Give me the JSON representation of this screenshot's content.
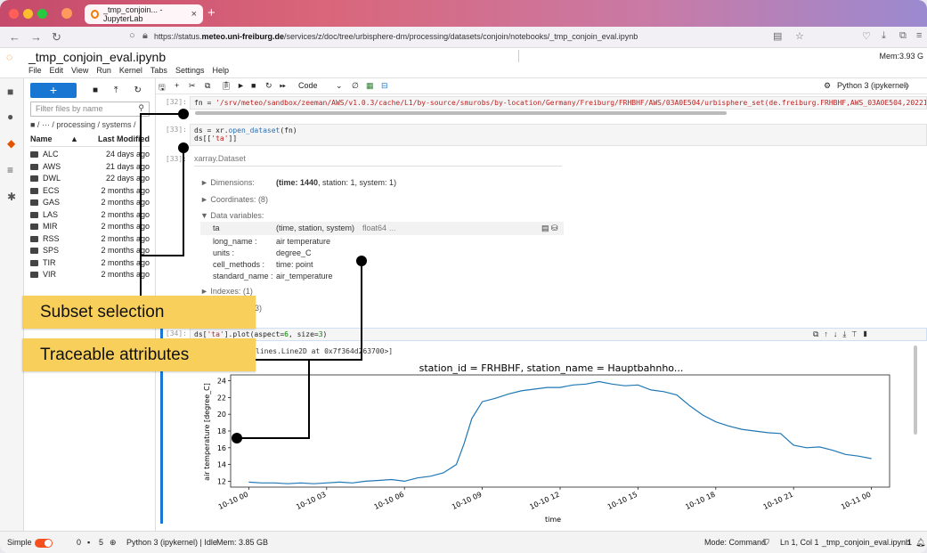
{
  "browser": {
    "tab_title": "_tmp_conjoin... - JupyterLab",
    "url_prefix": "https://status.",
    "url_domain": "meteo.uni-freiburg.de",
    "url_rest": "/services/z/doc/tree/urbisphere-dm/processing/datasets/conjoin/notebooks/_tmp_conjoin_eval.ipynb"
  },
  "jupyter": {
    "notebook_title": "_tmp_conjoin_eval.ipynb",
    "menu": [
      "File",
      "Edit",
      "View",
      "Run",
      "Kernel",
      "Tabs",
      "Settings",
      "Help"
    ],
    "memory": "Mem:3.93 G",
    "kernel": "Python 3 (ipykernel)",
    "cell_type": "Code"
  },
  "filebrowser": {
    "new_label": "+",
    "filter_placeholder": "Filter files by name",
    "breadcrumb": "■ / ··· / processing / systems /",
    "col_name": "Name",
    "col_modified": "Last Modified",
    "items": [
      {
        "name": "ALC",
        "modified": "24 days ago"
      },
      {
        "name": "AWS",
        "modified": "21 days ago"
      },
      {
        "name": "DWL",
        "modified": "22 days ago"
      },
      {
        "name": "ECS",
        "modified": "2 months ago"
      },
      {
        "name": "GAS",
        "modified": "2 months ago"
      },
      {
        "name": "LAS",
        "modified": "2 months ago"
      },
      {
        "name": "MIR",
        "modified": "2 months ago"
      },
      {
        "name": "RSS",
        "modified": "2 months ago"
      },
      {
        "name": "SPS",
        "modified": "2 months ago"
      },
      {
        "name": "TIR",
        "modified": "2 months ago"
      },
      {
        "name": "VIR",
        "modified": "2 months ago"
      }
    ]
  },
  "cells": {
    "c32_prompt": "[32]:",
    "c32_code_a": "fn = ",
    "c32_code_b": "'/srv/meteo/sandbox/zeeman/AWS/v1.0.3/cache/L1/by-source/smurobs/by-location/Germany/Freiburg/FRHBHF/AWS/03A0E504/urbisphere_set(de.freiburg.FRHBHF,AWS_03A0E504,202210",
    "c33_prompt": "[33]:",
    "c33_line1a": "ds = xr.",
    "c33_line1b": "open_dataset",
    "c33_line1c": "(fn)",
    "c33_line2a": "ds[[",
    "c33_line2b": "'ta'",
    "c33_line2c": "]]",
    "c33_out_prompt": "[33]:",
    "dataset_title": "xarray.Dataset",
    "dimensions_label": "► Dimensions:",
    "dimensions_value_a": "(time: 1440",
    "dimensions_value_b": ", station: 1, system: 1)",
    "coordinates_label": "► Coordinates:  (8)",
    "datavars_label": "▼ Data variables:",
    "var_name": "ta",
    "var_dims": "(time, station, system)",
    "var_dtype": "float64",
    "var_dots": "...",
    "attrs": [
      {
        "k": "long_name :",
        "v": "air temperature"
      },
      {
        "k": "units :",
        "v": "degree_C"
      },
      {
        "k": "cell_methods :",
        "v": "time: point"
      },
      {
        "k": "standard_name :",
        "v": "air_temperature"
      }
    ],
    "indexes_label": "► Indexes:  (1)",
    "attributes_label": "3)",
    "c34_prompt": "[34]:",
    "c34_code_a": "ds[",
    "c34_code_b": "'ta'",
    "c34_code_c": "].plot(aspect=",
    "c34_code_d": "6",
    "c34_code_e": ", size=",
    "c34_code_f": "3",
    "c34_code_g": ")",
    "c34_out": "lines.Line2D at 0x7f364d263700>]"
  },
  "callouts": {
    "subset": "Subset selection",
    "traceable": "Traceable attributes"
  },
  "status": {
    "mode": "Simple",
    "n0": "0",
    "n1": "5",
    "kernel_state": "Python 3 (ipykernel) | Idle",
    "mem": "Mem: 3.85 GB",
    "cmd_mode": "Mode: Command",
    "pos": "Ln 1, Col 1",
    "file": "_tmp_conjoin_eval.ipynb",
    "count": "1"
  },
  "colors": {
    "accent": "#1976d2",
    "callout": "#f8cf5a",
    "line": "#1f77b4"
  },
  "chart_data": {
    "type": "line",
    "title": "station_id = FRHBHF, station_name = Hauptbahnho...",
    "xlabel": "time",
    "ylabel": "air temperature [degree_C]",
    "x_ticks": [
      "10-10 00",
      "10-10 03",
      "10-10 06",
      "10-10 09",
      "10-10 12",
      "10-10 15",
      "10-10 18",
      "10-10 21",
      "10-11 00"
    ],
    "y_ticks": [
      12,
      14,
      16,
      18,
      20,
      22,
      24
    ],
    "ylim": [
      11.3,
      24.7
    ],
    "xlim_hours": [
      -0.7,
      24.7
    ],
    "series": [
      {
        "x_hours": [
          0,
          0.5,
          1,
          1.5,
          2,
          2.5,
          3,
          3.5,
          4,
          4.5,
          5,
          5.5,
          6,
          6.5,
          7,
          7.5,
          8,
          8.3,
          8.6,
          9,
          9.5,
          10,
          10.5,
          11,
          11.5,
          12,
          12.5,
          13,
          13.5,
          14,
          14.5,
          15,
          15.5,
          16,
          16.5,
          17,
          17.5,
          18,
          18.5,
          19,
          19.5,
          20,
          20.5,
          21,
          21.5,
          22,
          22.5,
          23,
          23.5,
          24
        ],
        "values": [
          11.9,
          11.8,
          11.8,
          11.7,
          11.8,
          11.7,
          11.8,
          11.9,
          11.8,
          12.0,
          12.1,
          12.2,
          12.0,
          12.4,
          12.6,
          13.0,
          14.0,
          16.5,
          19.5,
          21.5,
          21.9,
          22.4,
          22.8,
          23.0,
          23.2,
          23.2,
          23.5,
          23.6,
          23.9,
          23.6,
          23.4,
          23.5,
          22.9,
          22.7,
          22.3,
          21.0,
          19.9,
          19.1,
          18.6,
          18.2,
          18.0,
          17.8,
          17.7,
          16.3,
          16.0,
          16.1,
          15.7,
          15.2,
          15.0,
          14.7
        ]
      }
    ]
  }
}
